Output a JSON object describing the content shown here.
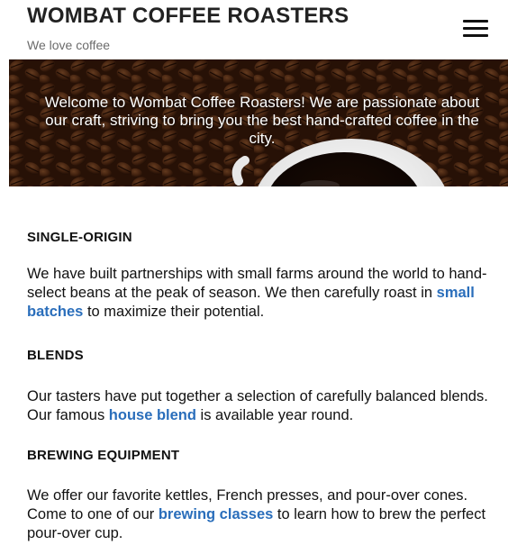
{
  "header": {
    "title": "WOMBAT COFFEE ROASTERS",
    "tagline": "We love coffee",
    "menu_icon": "hamburger-menu-icon"
  },
  "hero": {
    "text": "Welcome to Wombat Coffee Roasters! We are passionate about our craft, striving to bring you the best hand-crafted coffee in the city."
  },
  "sections": [
    {
      "title": "SINGLE-ORIGIN",
      "body_before": "We have built partnerships with small farms around the world to hand-select beans at the peak of season. We then carefully roast in ",
      "link": "small batches",
      "body_after": " to maximize their potential."
    },
    {
      "title": "BLENDS",
      "body_before": "Our tasters have put together a selection of carefully balanced blends. Our famous ",
      "link": "house blend",
      "body_after": " is available year round."
    },
    {
      "title": "BREWING EQUIPMENT",
      "body_before": "We offer our favorite kettles, French presses, and pour-over cones. Come to one of our ",
      "link": "brewing classes",
      "body_after": " to learn how to brew the perfect pour-over cup."
    }
  ],
  "colors": {
    "link": "#2a6ebb",
    "tagline": "#6b6b6b",
    "text": "#111111"
  }
}
